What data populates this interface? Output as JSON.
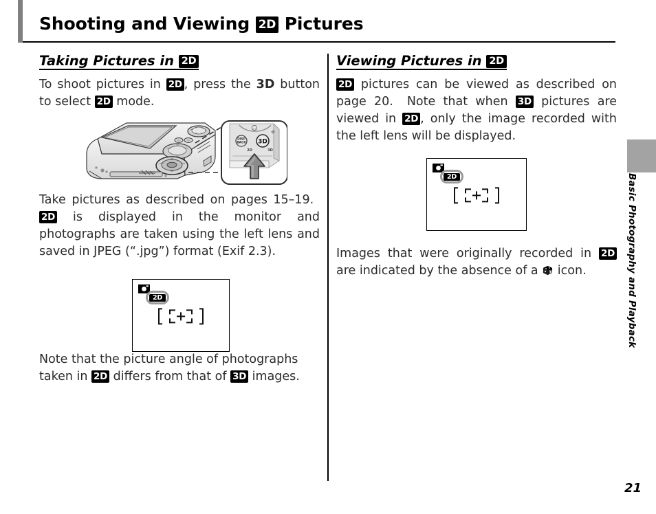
{
  "chapter": {
    "title_part1": "Shooting and Viewing",
    "title_badge": "2D",
    "title_part2": "Pictures"
  },
  "left_column": {
    "heading_text": "Taking Pictures in",
    "heading_badge": "2D",
    "para1": {
      "t1": "To shoot pictures in ",
      "b1": "2D",
      "t2": ", press the ",
      "bold3d": "3D",
      "t3": " button to select ",
      "b2": "2D",
      "t4": " mode."
    },
    "para2": {
      "t1": "Take pictures as described on pages 15–19.  ",
      "b1": "2D",
      "t2": " is displayed in the monitor and photographs are taken using the left lens and saved in JPEG (“.jpg”) format (Exif 2.3)."
    },
    "para3": {
      "t1": "Note that the picture angle of photographs taken in ",
      "b1": "2D",
      "t2": " differs from that of ",
      "b2": "3D",
      "t3": " images."
    },
    "monitor": {
      "camera_icon": "camera-icon",
      "badge": "2D",
      "focus_mark": "focus-frame"
    },
    "camera_figure": {
      "name": "camera-back-illustration",
      "callout_button_label": "3D",
      "callout_small_labels": [
        "2D",
        "3D"
      ],
      "callout_arrow": "up-arrow"
    }
  },
  "right_column": {
    "heading_text": "Viewing Pictures in",
    "heading_badge": "2D",
    "para1": {
      "b1": "2D",
      "t1": " pictures can be viewed as described on page 20.  Note that when ",
      "b2": "3D",
      "t2": " pictures are viewed in ",
      "b3": "2D",
      "t3": ", only the image recorded with the left lens will be displayed."
    },
    "para2": {
      "t1": "Images that were originally recorded in ",
      "b1": "2D",
      "t2": " are indicated by the absence of a ",
      "cube": "3D-cube-icon",
      "t3": " icon."
    },
    "monitor": {
      "camera_icon": "camera-icon",
      "badge": "2D",
      "focus_mark": "focus-frame"
    }
  },
  "side_tab": {
    "label": "Basic Photography and Playback",
    "block_color": "#a3a3a3"
  },
  "footer": {
    "page_number": "21"
  },
  "colors": {
    "accent_bar": "#808080",
    "text": "#2b2b2b",
    "badge_bg": "#000000",
    "badge_fg": "#ffffff",
    "monitor_oval": "#9a9a9a"
  }
}
